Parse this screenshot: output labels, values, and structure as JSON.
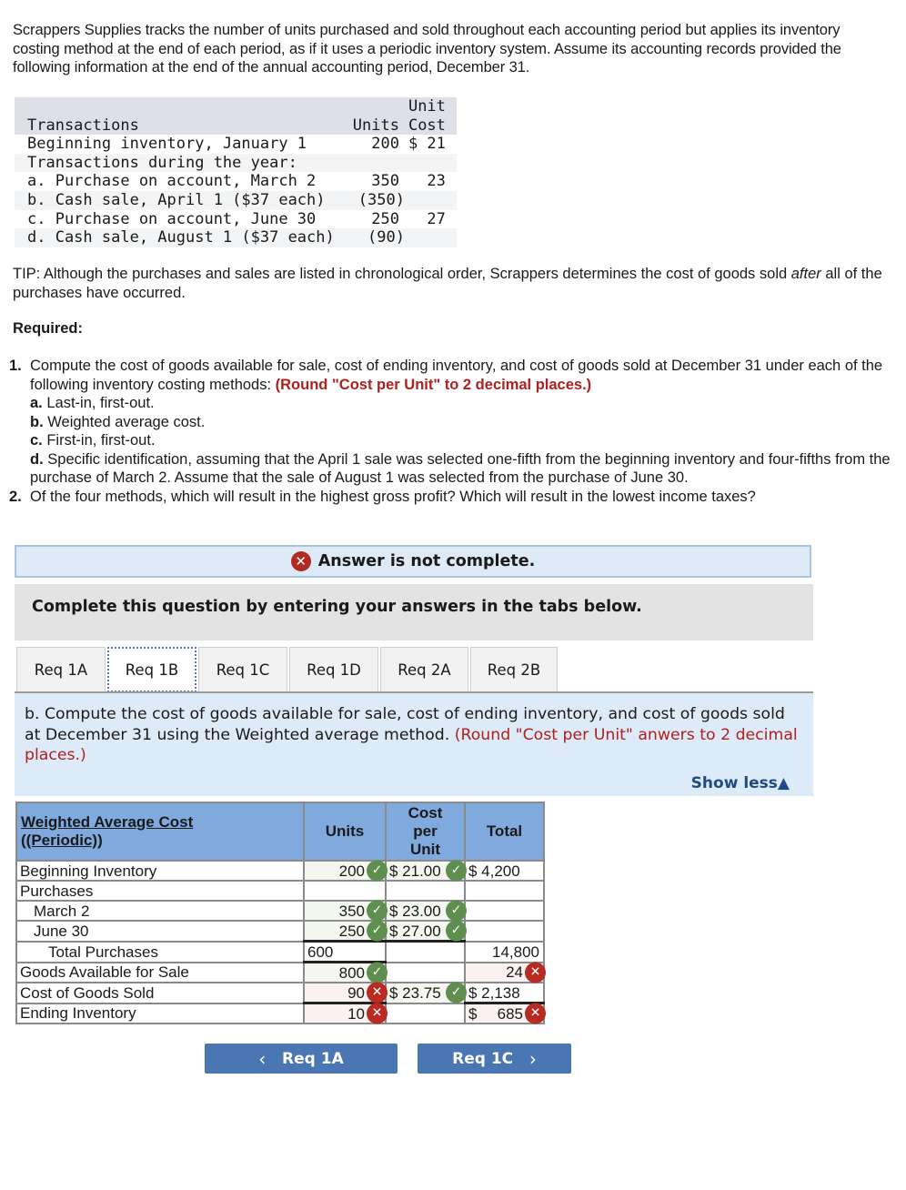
{
  "intro": "Scrappers Supplies tracks the number of units purchased and sold throughout each accounting period but applies its inventory costing method at the end of each period, as if it uses a periodic inventory system. Assume its accounting records provided the following information at the end of the annual accounting period, December 31.",
  "transactions_table": {
    "headers": {
      "transactions": "Transactions",
      "units": "Units",
      "unit_cost_line1": "Unit",
      "unit_cost_line2": "Cost"
    },
    "rows": [
      {
        "label": "Beginning inventory, January 1",
        "units": "200",
        "cost": "$ 21"
      },
      {
        "label": "Transactions during the year:",
        "units": "",
        "cost": ""
      },
      {
        "label": "a. Purchase on account, March 2",
        "units": "350",
        "cost": "23"
      },
      {
        "label": "b. Cash sale, April 1 ($37 each)",
        "units": "(350)",
        "cost": ""
      },
      {
        "label": "c. Purchase on account, June 30",
        "units": "250",
        "cost": "27"
      },
      {
        "label": "d. Cash sale, August 1 ($37 each)",
        "units": "(90)",
        "cost": ""
      }
    ]
  },
  "tip": {
    "prefix": "TIP: Although the purchases and sales are listed in chronological order, Scrappers determines the cost of goods sold ",
    "italic": "after",
    "suffix": " all of the purchases have occurred."
  },
  "required_label": "Required:",
  "requirements": {
    "r1_num": "1.",
    "r1_text": "Compute the cost of goods available for sale, cost of ending inventory, and cost of goods sold at December 31 under each of the following inventory costing methods: ",
    "r1_note": "(Round \"Cost per Unit\" to 2 decimal places.)",
    "subs": [
      {
        "letter": "a.",
        "text": " Last-in, first-out."
      },
      {
        "letter": "b.",
        "text": " Weighted average cost."
      },
      {
        "letter": "c.",
        "text": " First-in, first-out."
      },
      {
        "letter": "d.",
        "text": " Specific identification, assuming that the April 1 sale was selected one-fifth from the beginning inventory and four-fifths from the purchase of March 2. Assume that the sale of August 1 was selected from the purchase of June 30."
      }
    ],
    "r2_num": "2.",
    "r2_text": "Of the four methods, which will result in the highest gross profit? Which will result in the lowest income taxes?"
  },
  "answer_banner": {
    "icon": "x-circle-icon",
    "text": "Answer is not complete."
  },
  "complete_prompt": "Complete this question by entering your answers in the tabs below.",
  "tabs": [
    {
      "label": "Req 1A",
      "active": false
    },
    {
      "label": "Req 1B",
      "active": true
    },
    {
      "label": "Req 1C",
      "active": false
    },
    {
      "label": "Req 1D",
      "active": false
    },
    {
      "label": "Req 2A",
      "active": false
    },
    {
      "label": "Req 2B",
      "active": false
    }
  ],
  "prompt": {
    "text": "b. Compute the cost of goods available for sale, cost of ending inventory, and cost of goods sold at December 31 using the Weighted average method. ",
    "note": "(Round \"Cost per Unit\" anwers to 2 decimal places.)",
    "show_less": "Show less",
    "show_less_icon": "▲"
  },
  "worksheet": {
    "header": {
      "title_line1": "Weighted Average Cost",
      "title_line2": "(Periodic)",
      "units": "Units",
      "cpu_line1": "Cost",
      "cpu_line2": "per",
      "cpu_line3": "Unit",
      "total": "Total"
    },
    "rows": {
      "beginning": {
        "label": "Beginning Inventory",
        "units": "200",
        "units_status": "correct",
        "cpu": "$ 21.00",
        "cpu_status": "correct",
        "total": "$ 4,200"
      },
      "purchases": {
        "label": "Purchases"
      },
      "march": {
        "label": "March 2",
        "units": "350",
        "units_status": "correct",
        "cpu": "$ 23.00",
        "cpu_status": "correct"
      },
      "june": {
        "label": "June 30",
        "units": "250",
        "units_status": "correct",
        "cpu": "$ 27.00",
        "cpu_status": "correct"
      },
      "total_purchases": {
        "label": "Total Purchases",
        "units": "600",
        "total": "14,800"
      },
      "available": {
        "label": "Goods Available for Sale",
        "units": "800",
        "units_status": "correct",
        "total": "24",
        "total_status": "incorrect"
      },
      "cogs": {
        "label": "Cost of Goods Sold",
        "units": "90",
        "units_status": "incorrect",
        "cpu": "$ 23.75",
        "cpu_status": "correct",
        "total": "$ 2,138"
      },
      "ending": {
        "label": "Ending Inventory",
        "units": "10",
        "units_status": "incorrect",
        "total_prefix": "$",
        "total": "685",
        "total_status": "incorrect"
      }
    }
  },
  "nav": {
    "prev_label": "Req 1A",
    "prev_icon": "‹",
    "next_label": "Req 1C",
    "next_icon": "›"
  },
  "colors": {
    "accent_blue": "#4a76b4",
    "error_red": "#b82a22",
    "correct_green": "#5e8f4f",
    "header_blue": "#80a9dd"
  }
}
